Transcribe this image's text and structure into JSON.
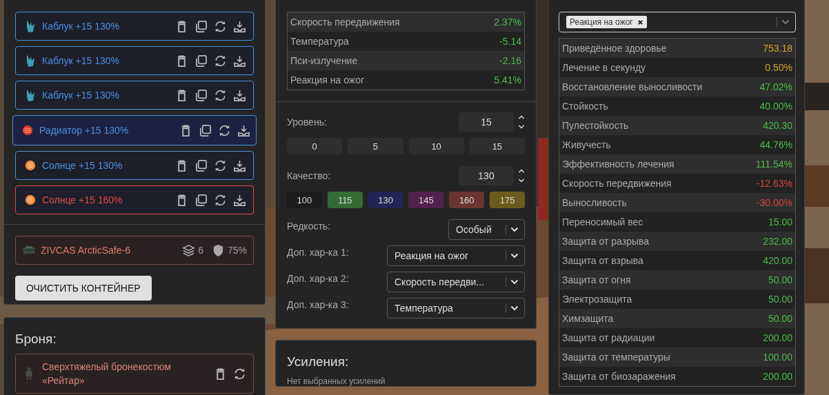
{
  "container": {
    "artifacts": [
      {
        "name": "Каблук +15 130%",
        "kind": "crystal",
        "color": "#4a8fe0",
        "selected": false
      },
      {
        "name": "Каблук +15 130%",
        "kind": "crystal",
        "color": "#4a8fe0",
        "selected": false
      },
      {
        "name": "Каблук +15 130%",
        "kind": "crystal",
        "color": "#4a8fe0",
        "selected": false
      },
      {
        "name": "Радиатор +15 130%",
        "kind": "radiator",
        "color": "#4a8fe0",
        "selected": true
      },
      {
        "name": "Солнце +15 130%",
        "kind": "sun",
        "color": "#4a8fe0",
        "selected": false
      },
      {
        "name": "Солнце +15 160%",
        "kind": "sun",
        "color": "#e04a4a",
        "selected": false
      }
    ],
    "case": {
      "name": "ZIVCAS ArcticSafe-6",
      "slots": "6",
      "protection": "75%"
    },
    "clear_button": "ОЧИСТИТЬ КОНТЕЙНЕР"
  },
  "armor": {
    "title": "Броня:",
    "item": "Сверхтяжелый бронекостюм «Рейтар»"
  },
  "artifact": {
    "stats": [
      {
        "name": "Скорость передвижения",
        "value": "2.37%",
        "color": "#4cbb4c"
      },
      {
        "name": "Температура",
        "value": "-5.14",
        "color": "#4cbb4c"
      },
      {
        "name": "Пси-излучение",
        "value": "-2.16",
        "color": "#4cbb4c"
      },
      {
        "name": "Реакция на ожог",
        "value": "5.41%",
        "color": "#4cbb4c"
      }
    ],
    "level_label": "Уровень:",
    "level": "15",
    "level_presets": [
      "0",
      "5",
      "10",
      "15"
    ],
    "quality_label": "Качество:",
    "quality": "130",
    "quality_presets": [
      {
        "label": "100",
        "color": "#1c1c1c"
      },
      {
        "label": "115",
        "color": "#356b35"
      },
      {
        "label": "130",
        "color": "#1f2657"
      },
      {
        "label": "145",
        "color": "#54204f"
      },
      {
        "label": "160",
        "color": "#6b3532"
      },
      {
        "label": "175",
        "color": "#6b5c1e"
      }
    ],
    "selects": [
      {
        "label": "Редкость:",
        "value": "Особый"
      },
      {
        "label": "Доп. хар-ка 1:",
        "value": "Реакция на ожог"
      },
      {
        "label": "Доп. хар-ка 2:",
        "value": "Скорость передви..."
      },
      {
        "label": "Доп. хар-ка 3:",
        "value": "Температура"
      }
    ]
  },
  "boosts": {
    "title": "Усиления:",
    "empty": "Нет выбранных усилений"
  },
  "totals": {
    "filter_tags": [
      "Реакция на ожог"
    ],
    "stats": [
      {
        "name": "Приведённое здоровье",
        "value": "753.18",
        "color": "#d4a52a"
      },
      {
        "name": "Лечение в секунду",
        "value": "0.50%",
        "color": "#d4a52a"
      },
      {
        "name": "Восстановление выносливости",
        "value": "47.02%",
        "color": "#4cbb4c"
      },
      {
        "name": "Стойкость",
        "value": "40.00%",
        "color": "#4cbb4c"
      },
      {
        "name": "Пулестойкость",
        "value": "420.30",
        "color": "#4cbb4c"
      },
      {
        "name": "Живучесть",
        "value": "44.76%",
        "color": "#4cbb4c"
      },
      {
        "name": "Эффективность лечения",
        "value": "111.54%",
        "color": "#4cbb4c"
      },
      {
        "name": "Скорость передвижения",
        "value": "-12.63%",
        "color": "#d94444"
      },
      {
        "name": "Выносливость",
        "value": "-30.00%",
        "color": "#d94444"
      },
      {
        "name": "Переносимый вес",
        "value": "15.00",
        "color": "#4cbb4c"
      },
      {
        "name": "Защита от разрыва",
        "value": "232.00",
        "color": "#4cbb4c"
      },
      {
        "name": "Защита от взрыва",
        "value": "420.00",
        "color": "#4cbb4c"
      },
      {
        "name": "Защита от огня",
        "value": "50.00",
        "color": "#4cbb4c"
      },
      {
        "name": "Электрозащита",
        "value": "50.00",
        "color": "#4cbb4c"
      },
      {
        "name": "Химзащита",
        "value": "50.00",
        "color": "#4cbb4c"
      },
      {
        "name": "Защита от радиации",
        "value": "200.00",
        "color": "#4cbb4c"
      },
      {
        "name": "Защита от температуры",
        "value": "100.00",
        "color": "#4cbb4c"
      },
      {
        "name": "Защита от биозаражения",
        "value": "200.00",
        "color": "#4cbb4c"
      }
    ]
  }
}
